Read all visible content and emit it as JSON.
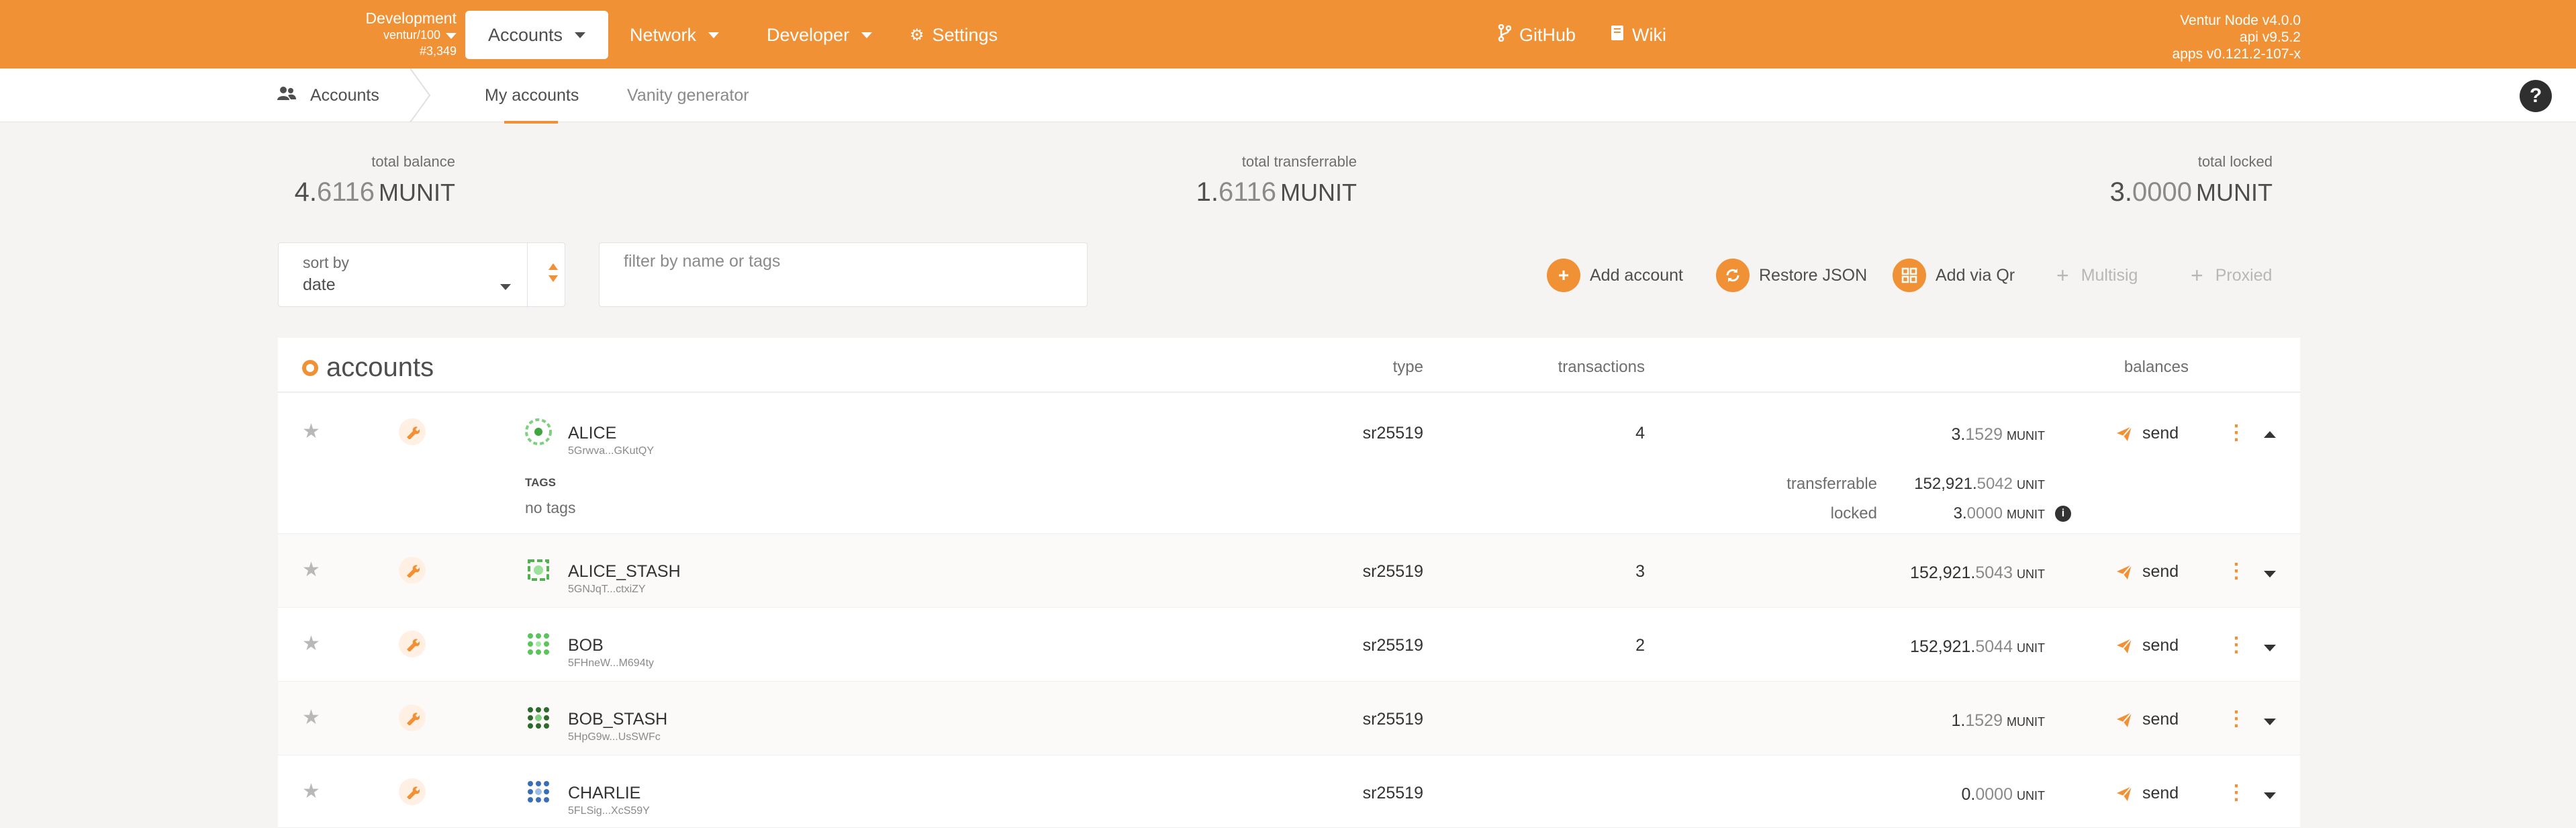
{
  "topbar": {
    "chain": "Development",
    "runtime": "ventur/100",
    "block": "#3,349",
    "tabs": [
      {
        "label": "Accounts"
      },
      {
        "label": "Network"
      },
      {
        "label": "Developer"
      },
      {
        "label": "Settings"
      }
    ],
    "links": [
      {
        "label": "GitHub"
      },
      {
        "label": "Wiki"
      }
    ],
    "version": {
      "node": "Ventur Node v4.0.0",
      "api": "api v9.5.2",
      "apps": "apps v0.121.2-107-x"
    }
  },
  "subnav": {
    "section": "Accounts",
    "tabs": [
      {
        "label": "My accounts"
      },
      {
        "label": "Vanity generator"
      }
    ],
    "help": "?"
  },
  "summary": {
    "total_balance": {
      "label": "total balance",
      "whole": "4.",
      "frac": "6116",
      "unit": "MUNIT"
    },
    "total_transferrable": {
      "label": "total transferrable",
      "whole": "1.",
      "frac": "6116",
      "unit": "MUNIT"
    },
    "total_locked": {
      "label": "total locked",
      "whole": "3.",
      "frac": "0000",
      "unit": "MUNIT"
    }
  },
  "controls": {
    "sort_label": "sort by",
    "sort_value": "date",
    "filter_placeholder": "filter by name or tags",
    "actions": [
      {
        "label": "Add account",
        "enabled": true
      },
      {
        "label": "Restore JSON",
        "enabled": true
      },
      {
        "label": "Add via Qr",
        "enabled": true
      },
      {
        "label": "Multisig",
        "enabled": false
      },
      {
        "label": "Proxied",
        "enabled": false
      }
    ]
  },
  "table": {
    "title": "accounts",
    "headers": {
      "type": "type",
      "transactions": "transactions",
      "balances": "balances"
    },
    "send_label": "send",
    "rows": [
      {
        "name": "ALICE",
        "address": "5Grwva...GKutQY",
        "type": "sr25519",
        "transactions": "4",
        "bal_whole": "3.",
        "bal_frac": "1529",
        "bal_unit": "MUNIT",
        "expanded": true,
        "tags_label": "TAGS",
        "tags_value": "no tags",
        "transferrable_label": "transferrable",
        "transferrable_whole": "152,921.",
        "transferrable_frac": "5042",
        "transferrable_unit": "UNIT",
        "locked_label": "locked",
        "locked_whole": "3.",
        "locked_frac": "0000",
        "locked_unit": "MUNIT"
      },
      {
        "name": "ALICE_STASH",
        "address": "5GNJqT...ctxiZY",
        "type": "sr25519",
        "transactions": "3",
        "bal_whole": "152,921.",
        "bal_frac": "5043",
        "bal_unit": "UNIT"
      },
      {
        "name": "BOB",
        "address": "5FHneW...M694ty",
        "type": "sr25519",
        "transactions": "2",
        "bal_whole": "152,921.",
        "bal_frac": "5044",
        "bal_unit": "UNIT"
      },
      {
        "name": "BOB_STASH",
        "address": "5HpG9w...UsSWFc",
        "type": "sr25519",
        "transactions": "",
        "bal_whole": "1.",
        "bal_frac": "1529",
        "bal_unit": "MUNIT"
      },
      {
        "name": "CHARLIE",
        "address": "5FLSig...XcS59Y",
        "type": "sr25519",
        "transactions": "",
        "bal_whole": "0.",
        "bal_frac": "0000",
        "bal_unit": "UNIT"
      }
    ]
  },
  "colors": {
    "accent": "#f19135",
    "page_bg": "#f5f4f3",
    "text": "#4e4e4e",
    "muted": "#8a8a8a"
  },
  "icons": {
    "chain_caret": "chevron-down-icon",
    "settings": "gear-icon",
    "github": "git-branch-icon",
    "wiki": "book-icon",
    "accounts_section": "users-icon",
    "help": "question-icon",
    "star": "star-icon",
    "account_settings": "wrench-icon",
    "send": "paper-plane-icon",
    "more": "kebab-icon"
  }
}
